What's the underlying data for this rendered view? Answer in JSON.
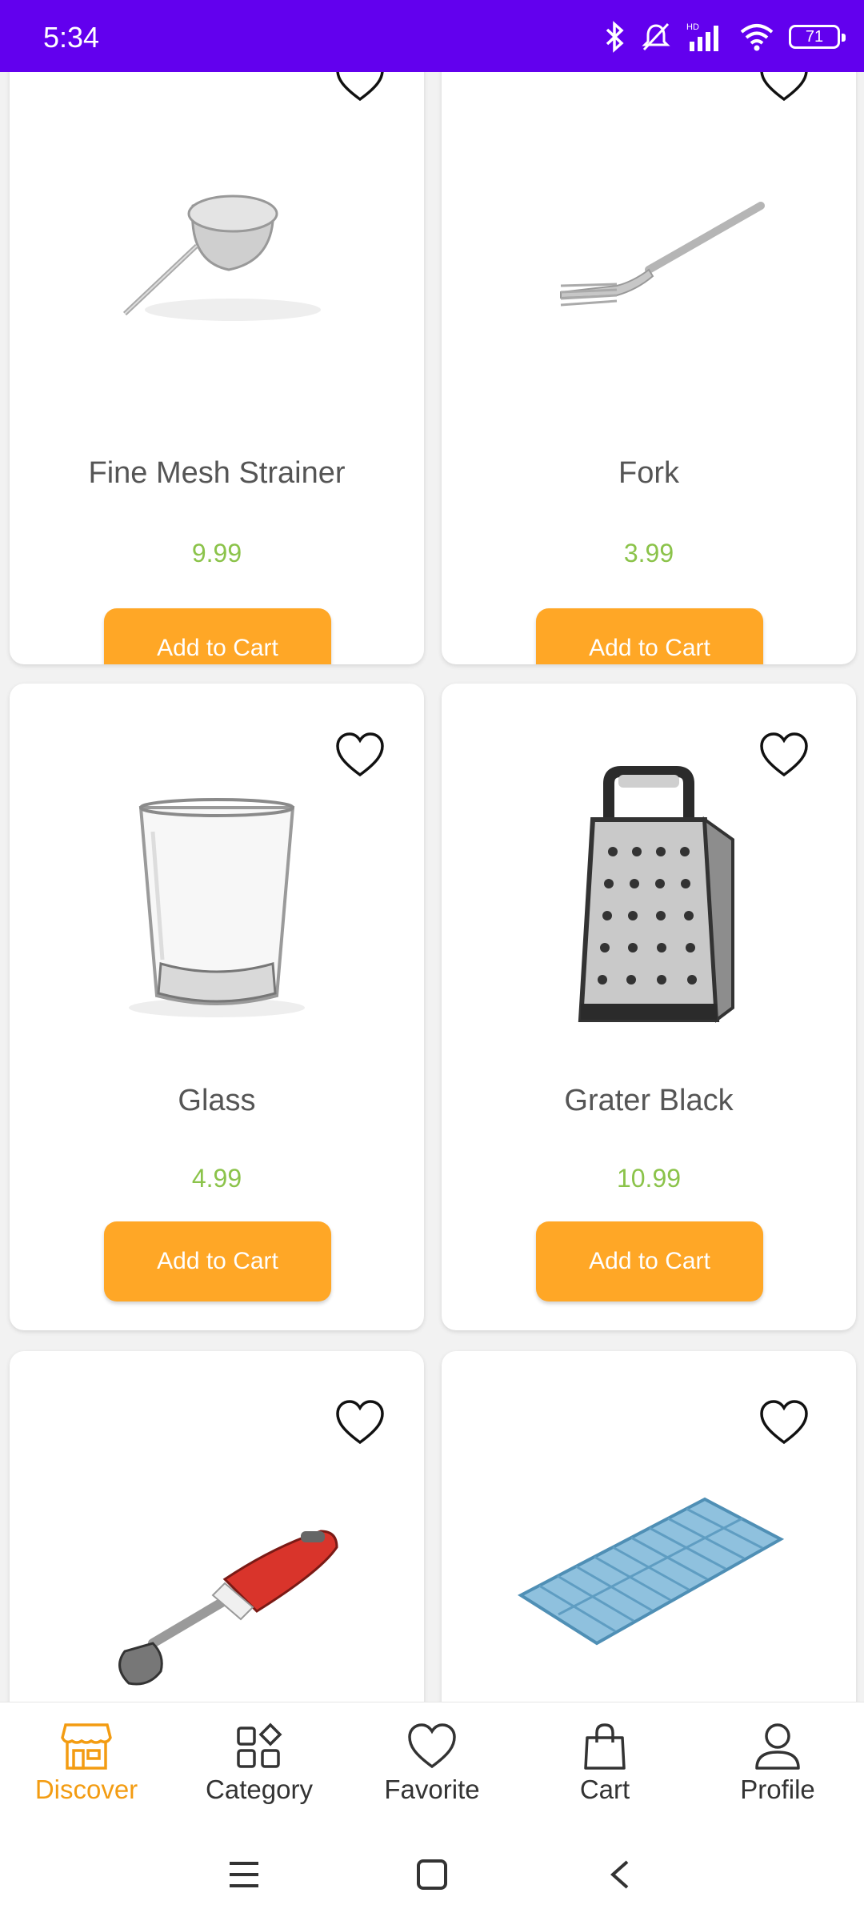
{
  "status_bar": {
    "time": "5:34",
    "battery_level": "71"
  },
  "products": [
    {
      "name": "Fine Mesh Strainer",
      "price": "9.99",
      "button_label": "Add to Cart",
      "image_icon": "strainer-image"
    },
    {
      "name": "Fork",
      "price": "3.99",
      "button_label": "Add to Cart",
      "image_icon": "fork-image"
    },
    {
      "name": "Glass",
      "price": "4.99",
      "button_label": "Add to Cart",
      "image_icon": "glass-image"
    },
    {
      "name": "Grater Black",
      "price": "10.99",
      "button_label": "Add to Cart",
      "image_icon": "grater-image"
    },
    {
      "name": "",
      "price": "",
      "button_label": "",
      "image_icon": "hand-blender-image"
    },
    {
      "name": "",
      "price": "",
      "button_label": "",
      "image_icon": "ice-tray-image"
    }
  ],
  "bottom_nav": {
    "items": [
      {
        "label": "Discover",
        "icon": "store-icon",
        "active": true
      },
      {
        "label": "Category",
        "icon": "category-icon",
        "active": false
      },
      {
        "label": "Favorite",
        "icon": "heart-icon",
        "active": false
      },
      {
        "label": "Cart",
        "icon": "bag-icon",
        "active": false
      },
      {
        "label": "Profile",
        "icon": "person-icon",
        "active": false
      }
    ]
  },
  "colors": {
    "status_bar": "#6200ee",
    "accent": "#ffa726",
    "price": "#8bc34a",
    "active_nav": "#f39c12"
  }
}
